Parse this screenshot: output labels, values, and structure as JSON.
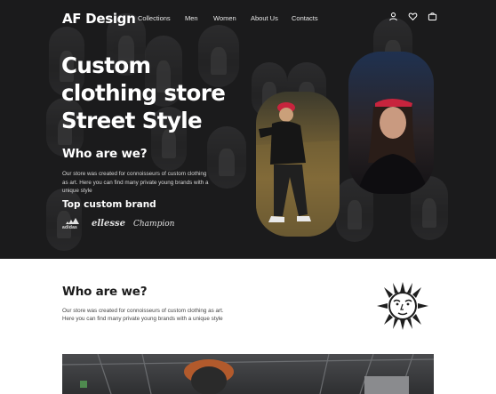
{
  "header": {
    "logo": "AF Design",
    "nav": [
      "Collections",
      "Men",
      "Women",
      "About Us",
      "Contacts"
    ],
    "icons": [
      "user-icon",
      "heart-icon",
      "bag-icon"
    ]
  },
  "hero": {
    "title_lines": [
      "Custom",
      "clothing store",
      "Street Style"
    ],
    "who_title": "Who are we?",
    "who_text": "Our store was created for connoisseurs of custom clothing as art. Here you can find many private young brands with a unique style",
    "brands_title": "Top custom brand",
    "brands": [
      "adidas",
      "ellesse",
      "Champion"
    ]
  },
  "about": {
    "title": "Who are we?",
    "text_lines": [
      "Our store was created for connoisseurs of custom clothing as art.",
      "Here you can find many private young brands with a unique style"
    ]
  },
  "colors": {
    "hero_bg": "#1b1b1c",
    "page_bg": "#ffffff",
    "accent_red": "#c8243d"
  }
}
